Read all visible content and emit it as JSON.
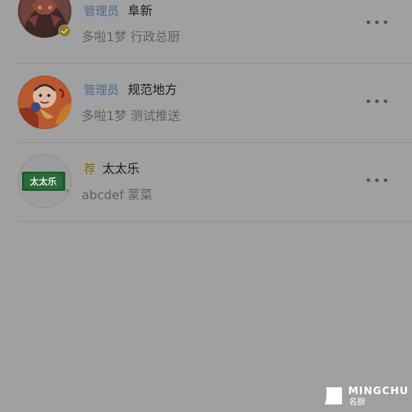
{
  "members": [
    {
      "tag": "管理员",
      "tag_type": "admin",
      "name": "阜新",
      "subtitle": "多啦1梦 行政总厨",
      "verified": true,
      "more_icon": "ellipsis-icon",
      "more_label": "•••"
    },
    {
      "tag": "管理员",
      "tag_type": "admin",
      "name": "规范地方",
      "subtitle": "多啦1梦 测试推送",
      "verified": false,
      "more_icon": "ellipsis-icon",
      "more_label": "•••"
    },
    {
      "tag": "荐",
      "tag_type": "recommend",
      "name": "太太乐",
      "subtitle": "abcdef 蒙菜",
      "verified": false,
      "more_icon": "ellipsis-icon",
      "more_label": "•••",
      "avatar_logo_text": "太太乐"
    }
  ],
  "watermark": {
    "name": "MINGCHU",
    "sub": "名厨"
  },
  "colors": {
    "overlay_background": "#a0a0a0",
    "admin_tag_bg": "#98a0a9",
    "admin_tag_text": "#5a6877",
    "recommend_tag_bg": "#aaa290",
    "recommend_tag_text": "#6f6134",
    "verified_badge": "#8c7a2a",
    "logo_green": "#1f5a2c"
  }
}
